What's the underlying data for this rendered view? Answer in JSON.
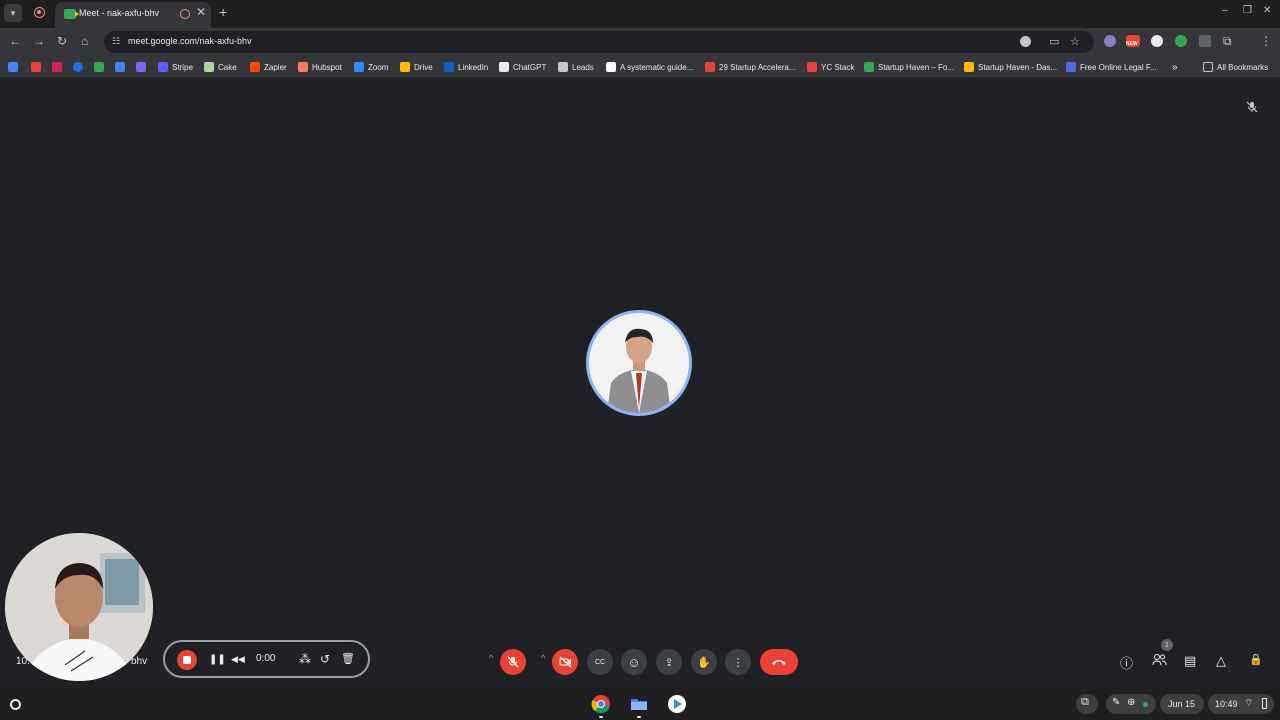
{
  "browser": {
    "tab_title": "Meet - nak-axfu-bhv",
    "tab_close_glyph": "✕",
    "new_tab_glyph": "+",
    "url": "meet.google.com/nak-axfu-bhv",
    "window_buttons": {
      "minimize": "–",
      "restore": "❐",
      "close": "✕"
    },
    "nav": {
      "back": "←",
      "forward": "→",
      "reload": "↻",
      "home": "⌂"
    },
    "omnibox_icons": {
      "site_info": "☷",
      "camera": "▭",
      "star": "☆"
    },
    "menu_glyph": "⋮",
    "new_badge": "NEW"
  },
  "bookmarks": {
    "items": [
      {
        "label": "Stripe",
        "color": "#635bff"
      },
      {
        "label": "Cake",
        "color": "#a8d8a0"
      },
      {
        "label": "Zapier",
        "color": "#ff4a00"
      },
      {
        "label": "Hubspot",
        "color": "#ff7a59"
      },
      {
        "label": "Zoom",
        "color": "#2d8cff"
      },
      {
        "label": "Drive",
        "color": "#fbbc04"
      },
      {
        "label": "LinkedIn",
        "color": "#0a66c2"
      },
      {
        "label": "ChatGPT",
        "color": "#e8eaed"
      },
      {
        "label": "Leads",
        "color": "#c4c7c5"
      },
      {
        "label": "A systematic guide...",
        "color": "#ffffff"
      },
      {
        "label": "29 Startup Accelera...",
        "color": "#ea4335"
      },
      {
        "label": "YC Stack",
        "color": "#ea4335"
      },
      {
        "label": "Startup Haven – Fo...",
        "color": "#34a853"
      },
      {
        "label": "Startup Haven - Das...",
        "color": "#fbbc04"
      },
      {
        "label": "Free Online Legal F...",
        "color": "#4f6bed"
      }
    ],
    "overflow": "»",
    "all_bookmarks": "All Bookmarks"
  },
  "meet": {
    "self_label_left": "10:",
    "self_label_right": "bhv",
    "mute_glyph": "🎤",
    "recorder": {
      "pause": "❚❚",
      "rewind": "◀◀",
      "time": "0:00",
      "grid": "⁂",
      "restart": "↺",
      "trash": "🗑"
    },
    "controls": {
      "caret": "^",
      "mic_off": "🎙",
      "cam_off": "⊘",
      "captions": "CC",
      "emoji": "☺",
      "present": "⇪",
      "raise_hand": "✋",
      "more": "⋮"
    },
    "right": {
      "info": "ⓘ",
      "people": "👥",
      "people_count": "1",
      "chat": "▤",
      "activities": "△",
      "host": "🔒"
    }
  },
  "shelf": {
    "date": "Jun 15",
    "time": "10:49"
  }
}
